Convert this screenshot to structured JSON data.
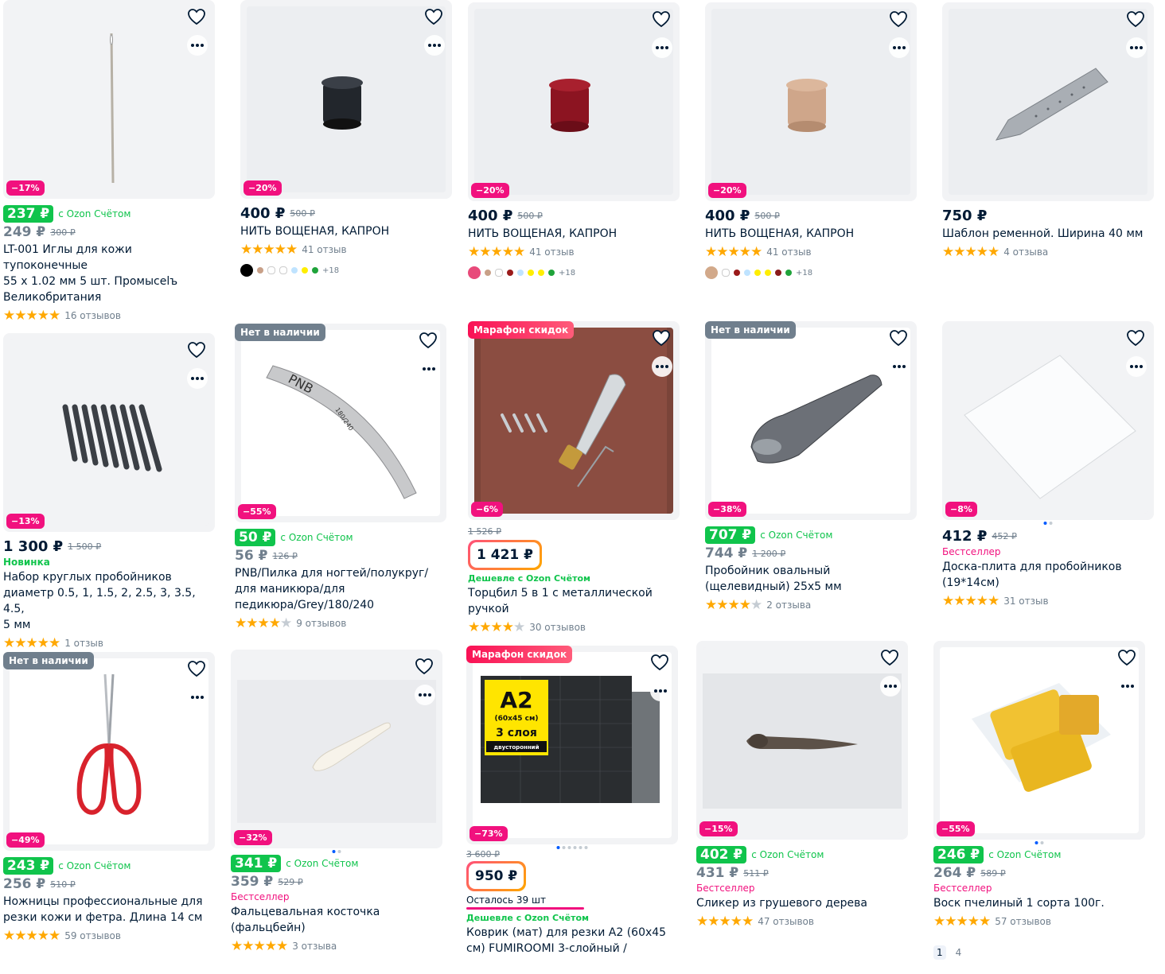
{
  "products": [
    {
      "id": "p1",
      "badge": "",
      "discount": "−17%",
      "ozon_price": "237 ₽",
      "ozon_label": "с Ozon Счётом",
      "price": "249 ₽",
      "old_price": "300 ₽",
      "tag": "",
      "title_lines": [
        "LT-001 Иглы для кожи тупоконечные",
        "55 x 1.02 мм 5 шт. Промысelъ",
        "Великобритания"
      ],
      "rating": 5,
      "reviews": "16 отзывов"
    },
    {
      "id": "p2",
      "discount": "−20%",
      "price": "400 ₽",
      "old_price": "500 ₽",
      "title_lines": [
        "НИТЬ ВОЩЕНАЯ, КАПРОН"
      ],
      "rating": 5,
      "reviews": "41 отзыв",
      "swatches": [
        "#000000",
        "#c8a088",
        "#ffffff",
        "#ffffff",
        "#bfe3ff",
        "#ffee00",
        "#1fa33a"
      ],
      "swatches_more": "+18"
    },
    {
      "id": "p3",
      "discount": "−20%",
      "price": "400 ₽",
      "old_price": "500 ₽",
      "title_lines": [
        "НИТЬ ВОЩЕНАЯ, КАПРОН"
      ],
      "rating": 5,
      "reviews": "41 отзыв",
      "swatches": [
        "#e84a7a",
        "#c8a088",
        "#ffffff",
        "#9a1b1b",
        "#bfe3ff",
        "#ffee00",
        "#ffee00",
        "#1fa33a"
      ],
      "swatches_more": "+18"
    },
    {
      "id": "p4",
      "discount": "−20%",
      "price": "400 ₽",
      "old_price": "500 ₽",
      "title_lines": [
        "НИТЬ ВОЩЕНАЯ, КАПРОН"
      ],
      "rating": 5,
      "reviews": "41 отзыв",
      "swatches": [
        "#d2a98a",
        "#ffffff",
        "#9a1b1b",
        "#bfe3ff",
        "#ffee00",
        "#ffee00",
        "#8a1b1b",
        "#1fa33a"
      ],
      "swatches_more": "+18"
    },
    {
      "id": "p5",
      "price": "750 ₽",
      "title_lines": [
        "Шаблон ременной. Ширина 40 мм"
      ],
      "rating": 5,
      "reviews": "4 отзыва"
    },
    {
      "id": "p6",
      "discount": "−13%",
      "price": "1 300 ₽",
      "old_price": "1 500 ₽",
      "tag": "Новинка",
      "title_lines": [
        "Набор круглых пробойников",
        "диаметр 0.5, 1, 1.5, 2, 2.5, 3, 3.5, 4.5,",
        "5 мм"
      ],
      "rating": 5,
      "reviews": "1 отзыв"
    },
    {
      "id": "p7",
      "badge": "Нет в наличии",
      "discount": "−55%",
      "ozon_price": "50 ₽",
      "ozon_label": "с Ozon Счётом",
      "price": "56 ₽",
      "old_price": "126 ₽",
      "title_lines": [
        "PNB/Пилка для ногтей/полукруг/",
        "для маникюра/для",
        "педикюра/Grey/180/240"
      ],
      "rating": 4,
      "reviews": "9 отзывов"
    },
    {
      "id": "p8",
      "badge": "Марафон скидок",
      "discount": "−6%",
      "old_price": "1 526 ₽",
      "promo_price": "1 421 ₽",
      "cheaper": "Дешевле с Ozon Счётом",
      "title_lines": [
        "Торцбил 5 в 1 с металлической",
        "ручкой"
      ],
      "rating": 4,
      "reviews": "30 отзывов"
    },
    {
      "id": "p9",
      "badge": "Нет в наличии",
      "discount": "−38%",
      "ozon_price": "707 ₽",
      "ozon_label": "с Ozon Счётом",
      "price": "744 ₽",
      "old_price": "1 200 ₽",
      "title_lines": [
        "Пробойник овальный",
        "(щелевидный) 25x5 мм"
      ],
      "rating": 4,
      "reviews": "2 отзыва"
    },
    {
      "id": "p10",
      "discount": "−8%",
      "price": "412 ₽",
      "old_price": "452 ₽",
      "tag": "Бестселлер",
      "title_lines": [
        "Доска-плита для пробойников",
        "(19*14см)"
      ],
      "rating": 5,
      "reviews": "31 отзыв"
    },
    {
      "id": "p11",
      "badge": "Нет в наличии",
      "discount": "−49%",
      "ozon_price": "243 ₽",
      "ozon_label": "с Ozon Счётом",
      "price": "256 ₽",
      "old_price": "510 ₽",
      "title_lines": [
        "Ножницы профессиональные для",
        "резки кожи и фетра. Длина 14 см"
      ],
      "rating": 5,
      "reviews": "59 отзывов"
    },
    {
      "id": "p12",
      "discount": "−32%",
      "ozon_price": "341 ₽",
      "ozon_label": "с Ozon Счётом",
      "price": "359 ₽",
      "old_price": "529 ₽",
      "tag": "Бестселлер",
      "title_lines": [
        "Фальцевальная косточка",
        "(фальцбейн)"
      ],
      "rating": 5,
      "reviews": "3 отзыва"
    },
    {
      "id": "p13",
      "badge": "Марафон скидок",
      "discount": "−73%",
      "old_price": "3 600 ₽",
      "promo_price": "950 ₽",
      "stock_left": "Осталось 39 шт",
      "cheaper": "Дешевле с Ozon Счётом",
      "title_lines": [
        "Коврик (мат) для резки А2 (60x45",
        "см) FUMIROOMI 3-слойный /"
      ],
      "mat_text": {
        "size": "А2",
        "dims": "(60x45 см)",
        "layers": "3 слоя",
        "side": "двусторонний"
      }
    },
    {
      "id": "p14",
      "discount": "−15%",
      "ozon_price": "402 ₽",
      "ozon_label": "с Ozon Счётом",
      "price": "431 ₽",
      "old_price": "511 ₽",
      "tag": "Бестселлер",
      "title_lines": [
        "Сликер из грушевого дерева"
      ],
      "rating": 5,
      "reviews": "47 отзывов"
    },
    {
      "id": "p15",
      "discount": "−55%",
      "ozon_price": "246 ₽",
      "ozon_label": "с Ozon Счётом",
      "price": "264 ₽",
      "old_price": "589 ₽",
      "tag": "Бестселлер",
      "title_lines": [
        "Воск пчелиный 1 сорта 100г."
      ],
      "rating": 5,
      "reviews": "57 отзывов"
    }
  ],
  "pagination": [
    "1",
    "4"
  ],
  "p7_brand": "PNB",
  "p7_grit": "180/240",
  "colors": {
    "accent": "#005bff",
    "green": "#10c44c",
    "discount": "#f1117e",
    "star": "#ffa800",
    "text": "#001a34",
    "muted": "#707f8d"
  }
}
